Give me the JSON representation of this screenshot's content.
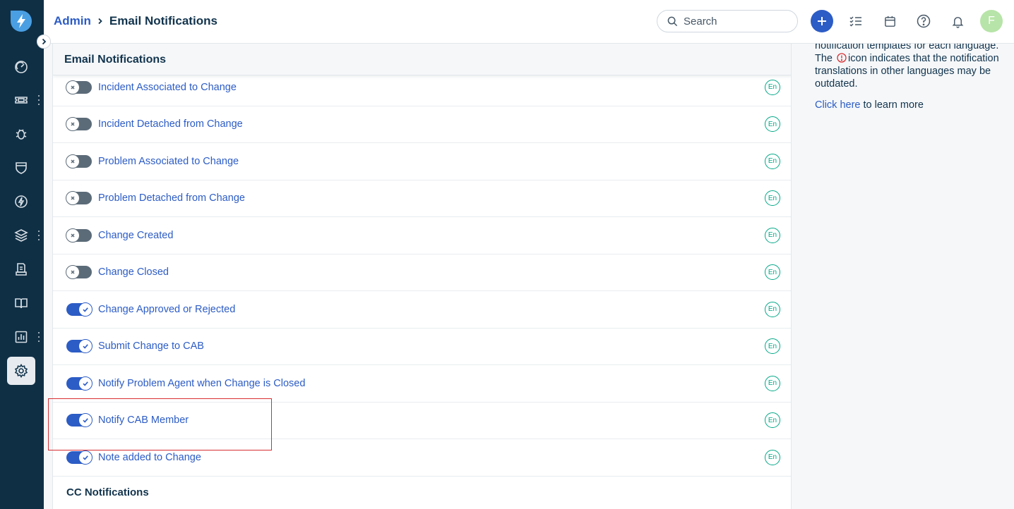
{
  "header": {
    "breadcrumb_parent": "Admin",
    "breadcrumb_current": "Email Notifications",
    "search_placeholder": "Search",
    "avatar_initial": "F"
  },
  "card": {
    "title": "Email Notifications",
    "rows": [
      {
        "label": "Incident Associated to Change",
        "enabled": false,
        "lang": "En"
      },
      {
        "label": "Incident Detached from Change",
        "enabled": false,
        "lang": "En"
      },
      {
        "label": "Problem Associated to Change",
        "enabled": false,
        "lang": "En"
      },
      {
        "label": "Problem Detached from Change",
        "enabled": false,
        "lang": "En"
      },
      {
        "label": "Change Created",
        "enabled": false,
        "lang": "En"
      },
      {
        "label": "Change Closed",
        "enabled": false,
        "lang": "En"
      },
      {
        "label": "Change Approved or Rejected",
        "enabled": true,
        "lang": "En"
      },
      {
        "label": "Submit Change to CAB",
        "enabled": true,
        "lang": "En"
      },
      {
        "label": "Notify Problem Agent when Change is Closed",
        "enabled": true,
        "lang": "En"
      },
      {
        "label": "Notify CAB Member",
        "enabled": true,
        "lang": "En"
      },
      {
        "label": "Note added to Change",
        "enabled": true,
        "lang": "En"
      }
    ],
    "next_section": "CC Notifications"
  },
  "side_panel": {
    "line_1": "notification templates for each language.",
    "line_2a": "The",
    "line_2b": "icon indicates that the notification",
    "line_3": "translations in other languages may be",
    "line_4": "outdated.",
    "link_text": "Click here",
    "link_suffix": " to learn more"
  },
  "colors": {
    "sidebar": "#0f2f45",
    "accent": "#2c5cc5",
    "lang_badge": "#00a886",
    "toggle_off": "#5c6b78",
    "highlight": "#d72d30",
    "warning": "#d72d30"
  },
  "icons": {
    "sidebar": [
      "dashboard-icon",
      "ticket-icon",
      "bug-icon",
      "shield-icon",
      "bolt-icon",
      "layers-icon",
      "document-icon",
      "book-icon",
      "analytics-icon",
      "settings-icon"
    ],
    "header": [
      "search-icon",
      "plus-icon",
      "checklist-icon",
      "calendar-icon",
      "help-icon",
      "bell-icon"
    ]
  }
}
